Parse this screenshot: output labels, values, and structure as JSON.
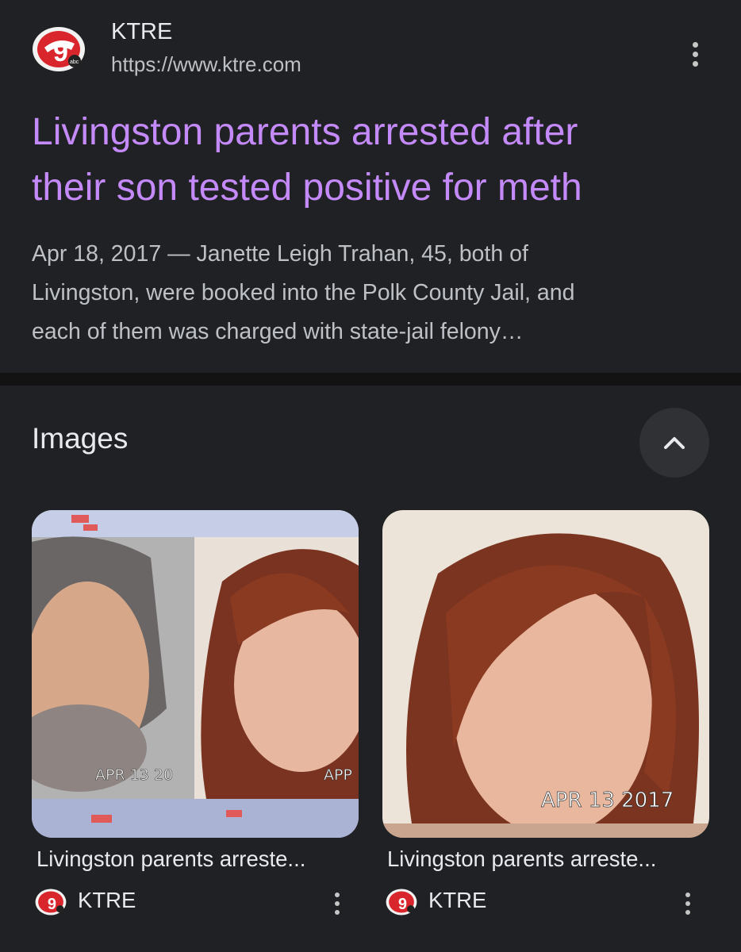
{
  "result": {
    "site_name": "KTRE",
    "site_url": "https://www.ktre.com",
    "logo_icon": "ktre-channel-9-logo",
    "title_lines": [
      "Livingston parents arrested after",
      "their son tested positive for meth"
    ],
    "snippet_lines": [
      "Apr 18, 2017 — Janette Leigh Trahan, 45, both of",
      "Livingston, were booked into the Polk County Jail, and",
      "each of them was charged with state-jail felony…"
    ]
  },
  "images_section": {
    "heading": "Images",
    "collapse_icon": "chevron-up-icon",
    "cards": [
      {
        "caption": "Livingston parents arreste...",
        "source": "KTRE",
        "stamps": [
          "APR 13 20",
          "APP"
        ]
      },
      {
        "caption": "Livingston parents arreste...",
        "source": "KTRE",
        "stamps": [
          "APR 13 2017"
        ]
      }
    ]
  },
  "colors": {
    "background": "#202124",
    "title_link": "#c58af9",
    "snippet": "#bdc1c6",
    "divider": "#131314"
  }
}
